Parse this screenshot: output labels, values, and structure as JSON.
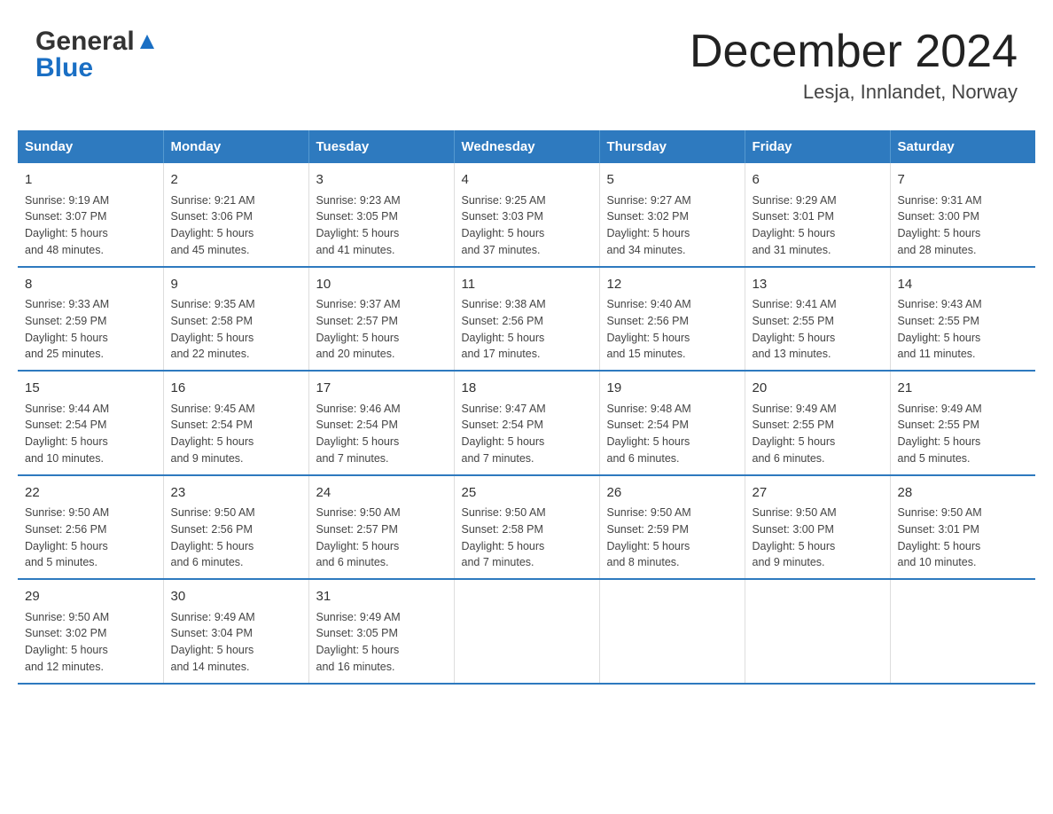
{
  "header": {
    "logo_general": "General",
    "logo_blue": "Blue",
    "month_year": "December 2024",
    "location": "Lesja, Innlandet, Norway"
  },
  "calendar": {
    "days_of_week": [
      "Sunday",
      "Monday",
      "Tuesday",
      "Wednesday",
      "Thursday",
      "Friday",
      "Saturday"
    ],
    "weeks": [
      [
        {
          "day": "1",
          "info": "Sunrise: 9:19 AM\nSunset: 3:07 PM\nDaylight: 5 hours\nand 48 minutes."
        },
        {
          "day": "2",
          "info": "Sunrise: 9:21 AM\nSunset: 3:06 PM\nDaylight: 5 hours\nand 45 minutes."
        },
        {
          "day": "3",
          "info": "Sunrise: 9:23 AM\nSunset: 3:05 PM\nDaylight: 5 hours\nand 41 minutes."
        },
        {
          "day": "4",
          "info": "Sunrise: 9:25 AM\nSunset: 3:03 PM\nDaylight: 5 hours\nand 37 minutes."
        },
        {
          "day": "5",
          "info": "Sunrise: 9:27 AM\nSunset: 3:02 PM\nDaylight: 5 hours\nand 34 minutes."
        },
        {
          "day": "6",
          "info": "Sunrise: 9:29 AM\nSunset: 3:01 PM\nDaylight: 5 hours\nand 31 minutes."
        },
        {
          "day": "7",
          "info": "Sunrise: 9:31 AM\nSunset: 3:00 PM\nDaylight: 5 hours\nand 28 minutes."
        }
      ],
      [
        {
          "day": "8",
          "info": "Sunrise: 9:33 AM\nSunset: 2:59 PM\nDaylight: 5 hours\nand 25 minutes."
        },
        {
          "day": "9",
          "info": "Sunrise: 9:35 AM\nSunset: 2:58 PM\nDaylight: 5 hours\nand 22 minutes."
        },
        {
          "day": "10",
          "info": "Sunrise: 9:37 AM\nSunset: 2:57 PM\nDaylight: 5 hours\nand 20 minutes."
        },
        {
          "day": "11",
          "info": "Sunrise: 9:38 AM\nSunset: 2:56 PM\nDaylight: 5 hours\nand 17 minutes."
        },
        {
          "day": "12",
          "info": "Sunrise: 9:40 AM\nSunset: 2:56 PM\nDaylight: 5 hours\nand 15 minutes."
        },
        {
          "day": "13",
          "info": "Sunrise: 9:41 AM\nSunset: 2:55 PM\nDaylight: 5 hours\nand 13 minutes."
        },
        {
          "day": "14",
          "info": "Sunrise: 9:43 AM\nSunset: 2:55 PM\nDaylight: 5 hours\nand 11 minutes."
        }
      ],
      [
        {
          "day": "15",
          "info": "Sunrise: 9:44 AM\nSunset: 2:54 PM\nDaylight: 5 hours\nand 10 minutes."
        },
        {
          "day": "16",
          "info": "Sunrise: 9:45 AM\nSunset: 2:54 PM\nDaylight: 5 hours\nand 9 minutes."
        },
        {
          "day": "17",
          "info": "Sunrise: 9:46 AM\nSunset: 2:54 PM\nDaylight: 5 hours\nand 7 minutes."
        },
        {
          "day": "18",
          "info": "Sunrise: 9:47 AM\nSunset: 2:54 PM\nDaylight: 5 hours\nand 7 minutes."
        },
        {
          "day": "19",
          "info": "Sunrise: 9:48 AM\nSunset: 2:54 PM\nDaylight: 5 hours\nand 6 minutes."
        },
        {
          "day": "20",
          "info": "Sunrise: 9:49 AM\nSunset: 2:55 PM\nDaylight: 5 hours\nand 6 minutes."
        },
        {
          "day": "21",
          "info": "Sunrise: 9:49 AM\nSunset: 2:55 PM\nDaylight: 5 hours\nand 5 minutes."
        }
      ],
      [
        {
          "day": "22",
          "info": "Sunrise: 9:50 AM\nSunset: 2:56 PM\nDaylight: 5 hours\nand 5 minutes."
        },
        {
          "day": "23",
          "info": "Sunrise: 9:50 AM\nSunset: 2:56 PM\nDaylight: 5 hours\nand 6 minutes."
        },
        {
          "day": "24",
          "info": "Sunrise: 9:50 AM\nSunset: 2:57 PM\nDaylight: 5 hours\nand 6 minutes."
        },
        {
          "day": "25",
          "info": "Sunrise: 9:50 AM\nSunset: 2:58 PM\nDaylight: 5 hours\nand 7 minutes."
        },
        {
          "day": "26",
          "info": "Sunrise: 9:50 AM\nSunset: 2:59 PM\nDaylight: 5 hours\nand 8 minutes."
        },
        {
          "day": "27",
          "info": "Sunrise: 9:50 AM\nSunset: 3:00 PM\nDaylight: 5 hours\nand 9 minutes."
        },
        {
          "day": "28",
          "info": "Sunrise: 9:50 AM\nSunset: 3:01 PM\nDaylight: 5 hours\nand 10 minutes."
        }
      ],
      [
        {
          "day": "29",
          "info": "Sunrise: 9:50 AM\nSunset: 3:02 PM\nDaylight: 5 hours\nand 12 minutes."
        },
        {
          "day": "30",
          "info": "Sunrise: 9:49 AM\nSunset: 3:04 PM\nDaylight: 5 hours\nand 14 minutes."
        },
        {
          "day": "31",
          "info": "Sunrise: 9:49 AM\nSunset: 3:05 PM\nDaylight: 5 hours\nand 16 minutes."
        },
        {
          "day": "",
          "info": ""
        },
        {
          "day": "",
          "info": ""
        },
        {
          "day": "",
          "info": ""
        },
        {
          "day": "",
          "info": ""
        }
      ]
    ]
  }
}
